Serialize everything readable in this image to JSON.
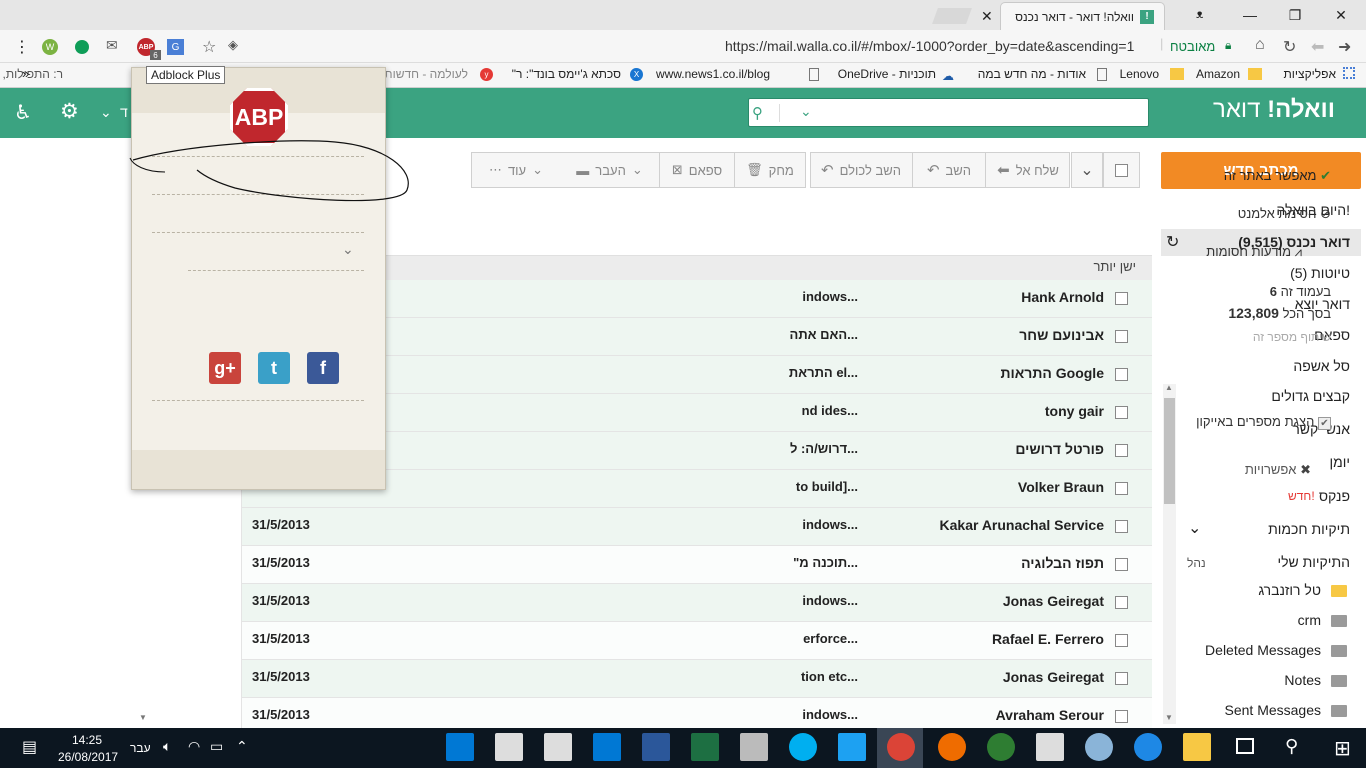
{
  "browser": {
    "tab_active": "וואלה! דואר - דואר נכנס",
    "tab_inactive": "",
    "url": "https://mail.walla.co.il/#/mbox/-1000?order_by=date&ascending=1",
    "secure_label": "מאובטח",
    "tooltip": "Adblock Plus",
    "ext_badge": "6"
  },
  "bookmarks": [
    "אפליקציות",
    "Amazon",
    "Lenovo",
    "אודות - מה חדש במה",
    "OneDrive - תוכניות",
    "www.news1.co.il/blog",
    "\"סכתא ג'יימס בונד\": ר",
    "לעולמה - חדשות",
    "ר: התפילות, ר"
  ],
  "header": {
    "logo": "וואלה!",
    "logo_sub": "דואר",
    "left_text": "ד"
  },
  "sidebar": {
    "compose": "מכתב חדש",
    "items": [
      "היום בוואלה!",
      "דואר נכנס (9,515)",
      "טיוטות (5)",
      "דואר יוצא",
      "ספאם",
      "סל אשפה",
      "קבצים גדולים",
      "אנשי קשר",
      "יומן",
      "פנקס"
    ],
    "new_badge": "חדש!",
    "smart_folders": "תיקיות חכמות",
    "my_folders": "התיקיות שלי",
    "manage": "נהל",
    "folders": [
      "טל רוזנברג",
      "crm",
      "Deleted Messages",
      "Notes",
      "Sent Messages"
    ]
  },
  "toolbar": {
    "forward": "שלח אל",
    "reply": "השב",
    "reply_all": "השב לכולם",
    "delete": "מחק",
    "spam": "ספאם",
    "move": "העבר",
    "more": "עוד"
  },
  "list": {
    "sort_label": "ישן יותר",
    "rows": [
      {
        "sender": "Hank Arnold",
        "subject": "indows...",
        "date": ""
      },
      {
        "sender": "אבינועם שחר",
        "subject": "האם אתה...",
        "date": ""
      },
      {
        "sender": "התראות Google",
        "subject": "התראת el...",
        "date": ""
      },
      {
        "sender": "tony gair",
        "subject": "nd ides...",
        "date": ""
      },
      {
        "sender": "פורטל דרושים",
        "subject": "דרוש/ה: ל...",
        "date": ""
      },
      {
        "sender": "Volker Braun",
        "subject": "to build]...",
        "date": ""
      },
      {
        "sender": "Kakar Arunachal Service",
        "subject": "indows...",
        "date": "31/5/2013"
      },
      {
        "sender": "תפוז הבלוגיה",
        "subject": "\"תוכנה מ...",
        "date": "31/5/2013"
      },
      {
        "sender": "Jonas Geiregat",
        "subject": "indows...",
        "date": "31/5/2013"
      },
      {
        "sender": "Rafael E. Ferrero",
        "subject": "erforce...",
        "date": "31/5/2013"
      },
      {
        "sender": "Jonas Geiregat",
        "subject": "tion etc...",
        "date": "31/5/2013"
      },
      {
        "sender": "Avraham Serour",
        "subject": "indows...",
        "date": "31/5/2013"
      }
    ]
  },
  "abp": {
    "logo": "ABP",
    "enabled": "מאפשר באתר זה",
    "block_element": "חסימת אלמנט",
    "blocked_items": "מודעות חסומות",
    "page_count": "6",
    "page_label": "בעמוד זה",
    "total_count": "123,809",
    "total_label": "בסך הכל",
    "share": "שיתוף מספר זה",
    "show_numbers": "הצגת מספרים באייקון",
    "options": "אפשרויות"
  },
  "taskbar": {
    "time": "14:25",
    "date": "26/08/2017",
    "lang": "עבר"
  },
  "colors": {
    "walla_green": "#3ba381",
    "compose_orange": "#f28a24",
    "row_tint": "#eef6f1"
  }
}
